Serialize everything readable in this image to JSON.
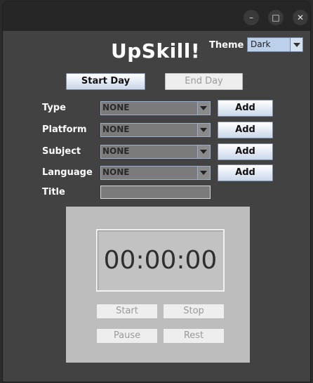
{
  "window": {
    "controls": {
      "minimize_icon": "–",
      "maximize_icon": "□",
      "close_icon": "✕"
    }
  },
  "header": {
    "title": "UpSkill!",
    "theme_label": "Theme",
    "theme_value": "Dark"
  },
  "day_controls": {
    "start_label": "Start Day",
    "end_label": "End Day"
  },
  "form": {
    "rows": [
      {
        "label": "Type",
        "value": "NONE",
        "add_label": "Add"
      },
      {
        "label": "Platform",
        "value": "NONE",
        "add_label": "Add"
      },
      {
        "label": "Subject",
        "value": "NONE",
        "add_label": "Add"
      },
      {
        "label": "Language",
        "value": "NONE",
        "add_label": "Add"
      }
    ],
    "title_label": "Title",
    "title_value": ""
  },
  "timer": {
    "display": "00:00:00",
    "start_label": "Start",
    "stop_label": "Stop",
    "pause_label": "Pause",
    "rest_label": "Rest"
  },
  "colors": {
    "window_bg": "#424242",
    "titlebar_bg": "#262626",
    "timer_panel_bg": "#bdbdbd",
    "accent_button": "#c9d7ea"
  }
}
